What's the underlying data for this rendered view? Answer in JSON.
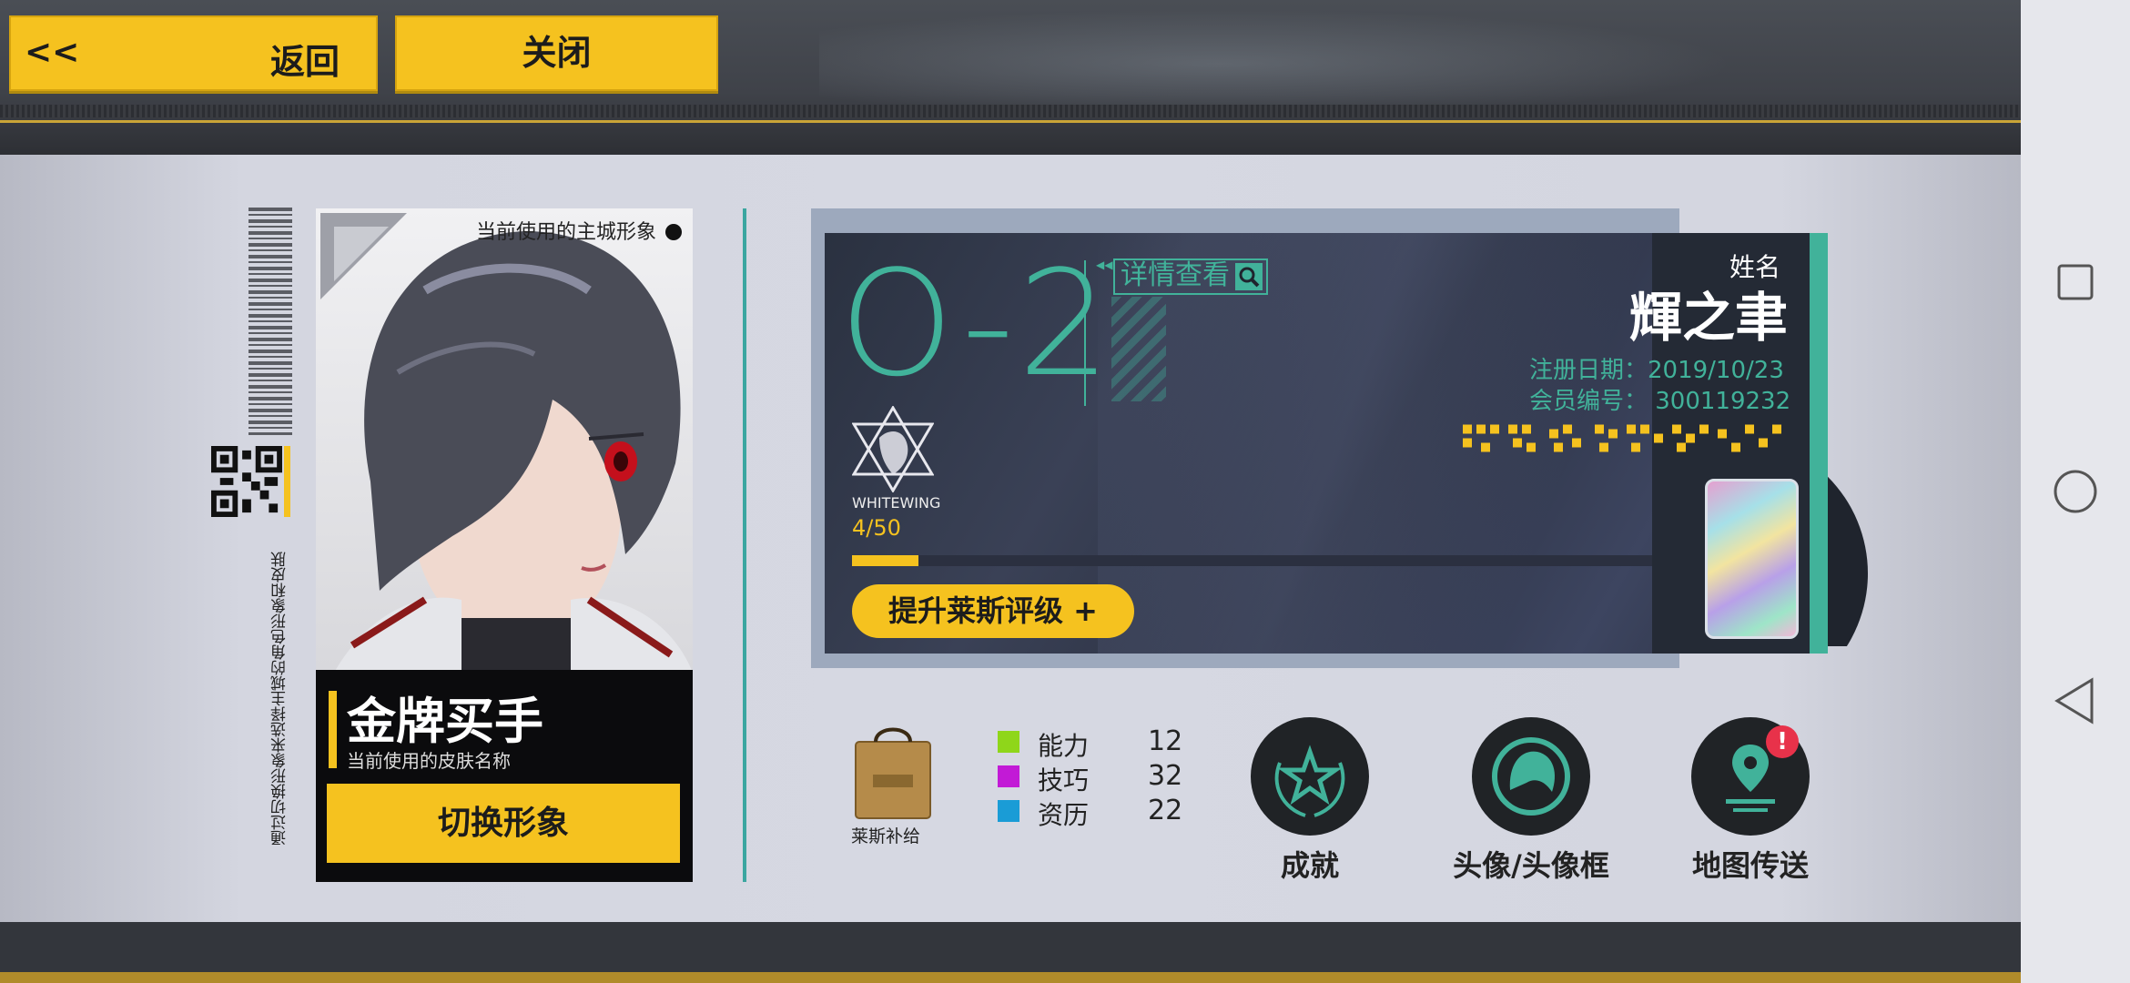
{
  "top": {
    "back_chevron": "<<",
    "back_label": "返回",
    "close_label": "关闭"
  },
  "side": {
    "vertical_hint": "通过切换形象来选择主城的角色形象和皮肤"
  },
  "portrait_card": {
    "caption": "当前使用的主城形象",
    "skin_name": "金牌买手",
    "skin_subtitle": "当前使用的皮肤名称",
    "switch_label": "切换形象"
  },
  "member_card": {
    "rank": "O-2",
    "detail_label": "详情查看",
    "logo_name": "WHITEWING",
    "progress_text": "4/50",
    "progress_fraction": 0.08,
    "upgrade_label": "提升莱斯评级 +",
    "name_label": "姓名",
    "name_value": "輝之聿",
    "reg_date": "注册日期：2019/10/23",
    "member_no": "会员编号：   300119232"
  },
  "supply": {
    "bag_label": "莱斯补给"
  },
  "stats": [
    {
      "label": "能力",
      "value": "12",
      "color": "#8fd61a"
    },
    {
      "label": "技巧",
      "value": "32",
      "color": "#c21ad6"
    },
    {
      "label": "资历",
      "value": "22",
      "color": "#1a9cd6"
    }
  ],
  "actions": {
    "achievement_label": "成就",
    "avatar_label": "头像/头像框",
    "map_label": "地图传送",
    "map_badge": "!"
  },
  "colors": {
    "accent_yellow": "#f5c21f",
    "accent_teal": "#41b29a"
  }
}
